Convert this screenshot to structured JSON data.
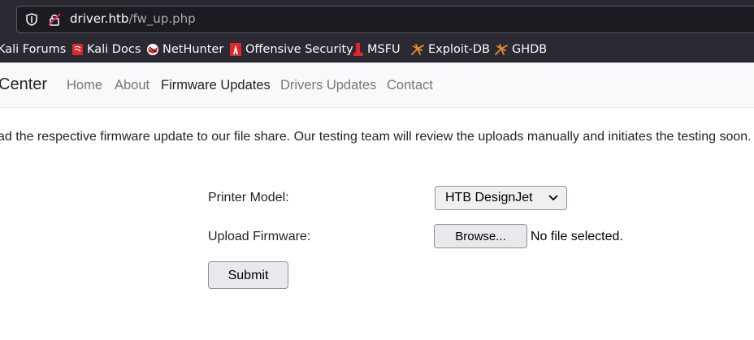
{
  "browser": {
    "url_host": "driver.htb",
    "url_path": "/fw_up.php",
    "bookmarks": [
      {
        "label": "Kali Forums",
        "icon": "kali-icon"
      },
      {
        "label": "Kali Docs",
        "icon": "kali-docs-icon"
      },
      {
        "label": "NetHunter",
        "icon": "nethunter-icon"
      },
      {
        "label": "Offensive Security",
        "icon": "offsec-icon"
      },
      {
        "label": "MSFU",
        "icon": "msfu-icon"
      },
      {
        "label": "Exploit-DB",
        "icon": "exploit-db-icon"
      },
      {
        "label": "GHDB",
        "icon": "ghdb-icon"
      }
    ]
  },
  "navbar": {
    "brand": "Center",
    "links": [
      "Home",
      "About",
      "Firmware Updates",
      "Drivers Updates",
      "Contact"
    ],
    "active": "Firmware Updates"
  },
  "main": {
    "intro": "ad the respective firmware update to our file share. Our testing team will review the uploads manually and initiates the testing soon.",
    "form": {
      "printer_label": "Printer Model:",
      "printer_value": "HTB DesignJet",
      "upload_label": "Upload Firmware:",
      "browse_label": "Browse...",
      "file_status": "No file selected.",
      "submit_label": "Submit"
    }
  },
  "colors": {
    "chrome_bg": "#2b2a33",
    "urlbar_bg": "#1c1b22",
    "navbar_bg": "#f8f9fa",
    "kali_red": "#e0262b",
    "exploit_orange": "#e8902b"
  }
}
